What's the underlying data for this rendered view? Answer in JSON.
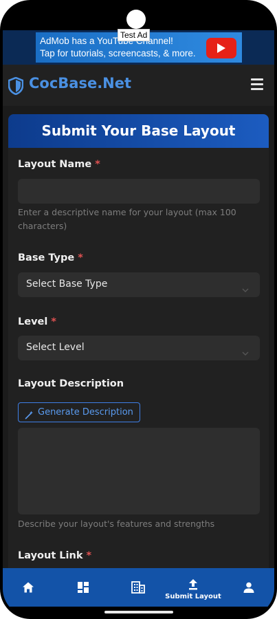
{
  "ad": {
    "line1": "AdMob has a YouTube Channel!",
    "line2": "Tap for tutorials, screencasts, & more.",
    "test_label": "Test Ad",
    "icon": "youtube-play-icon"
  },
  "header": {
    "brand": "CocBase.Net",
    "logo_icon": "shield-icon",
    "menu_icon": "hamburger-menu-icon",
    "brand_color": "#4a90e2"
  },
  "form": {
    "title": "Submit Your Base Layout",
    "layout_name": {
      "label": "Layout Name",
      "required_mark": "*",
      "value": "",
      "help": "Enter a descriptive name for your layout (max 100 characters)"
    },
    "base_type": {
      "label": "Base Type",
      "required_mark": "*",
      "selected": "Select Base Type"
    },
    "level": {
      "label": "Level",
      "required_mark": "*",
      "selected": "Select Level"
    },
    "description": {
      "label": "Layout Description",
      "generate_button": "Generate Description",
      "generate_icon": "magic-wand-icon",
      "value": "",
      "help": "Describe your layout's features and strengths"
    },
    "layout_link": {
      "label": "Layout Link",
      "required_mark": "*"
    }
  },
  "bottom_nav": {
    "items": [
      {
        "icon": "home-icon",
        "label": ""
      },
      {
        "icon": "dashboard-icon",
        "label": ""
      },
      {
        "icon": "buildings-icon",
        "label": ""
      },
      {
        "icon": "upload-icon",
        "label": "Submit Layout"
      },
      {
        "icon": "person-icon",
        "label": ""
      }
    ],
    "background": "#1353a8"
  }
}
